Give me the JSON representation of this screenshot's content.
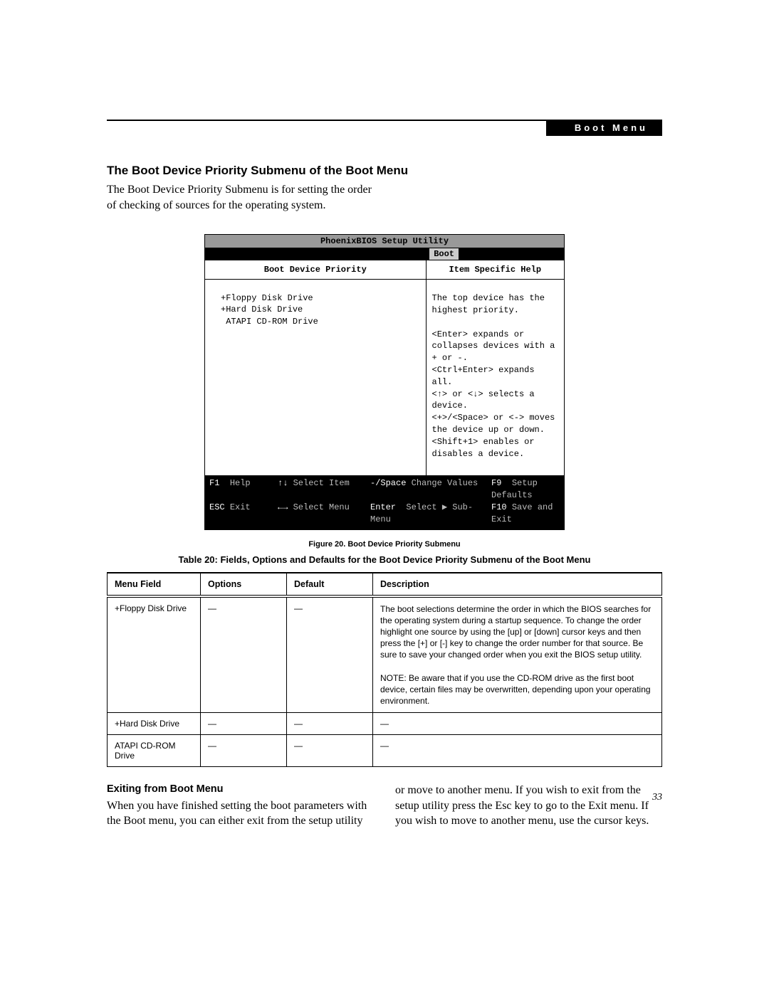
{
  "header": {
    "tab_label": "Boot Menu"
  },
  "section": {
    "heading": "The Boot Device Priority Submenu of the Boot Menu",
    "intro": "The Boot Device Priority Submenu is for setting the order of checking of sources for the operating system."
  },
  "bios": {
    "title": "PhoenixBIOS Setup Utility",
    "active_tab": "Boot",
    "left_heading": "Boot Device Priority",
    "right_heading": "Item Specific Help",
    "devices": {
      "d0": "+Floppy Disk Drive",
      "d1": "+Hard Disk Drive",
      "d2": " ATAPI CD-ROM Drive"
    },
    "help": {
      "l0": "The top device has the highest priority.",
      "l1": "<Enter> expands or collapses devices with a + or -.",
      "l2": "<Ctrl+Enter> expands all.",
      "l3": "<↑> or <↓> selects a device.",
      "l4": "<+>/<Space> or <-> moves the device up or down.",
      "l5": "<Shift+1> enables or disables a device."
    },
    "foot": {
      "r0c0k": "F1",
      "r0c0v": "Help",
      "r0c1k": "↑↓",
      "r0c1v": "Select Item",
      "r0c2k": "-/Space",
      "r0c2v": "Change Values",
      "r0c3k": "F9",
      "r0c3v": "Setup Defaults",
      "r1c0k": "ESC",
      "r1c0v": "Exit",
      "r1c1k": "←→",
      "r1c1v": "Select Menu",
      "r1c2k": "Enter",
      "r1c2v": "Select ▶ Sub-Menu",
      "r1c3k": "F10",
      "r1c3v": "Save and Exit"
    }
  },
  "figure_caption": "Figure 20.  Boot Device Priority Submenu",
  "table_caption": "Table 20: Fields, Options and Defaults for the Boot Device Priority Submenu of the Boot Menu",
  "table": {
    "headers": {
      "h0": "Menu Field",
      "h1": "Options",
      "h2": "Default",
      "h3": "Description"
    },
    "rows": {
      "r0": {
        "field": "+Floppy Disk Drive",
        "options": "—",
        "def": "—",
        "desc_a": "The boot selections determine the order in which the BIOS searches for the operating system during a startup sequence. To change the order highlight one source by using the [up] or [down] cursor keys and then press the [+] or [-] key to change the order number for that source. Be sure to save your changed order when you exit the BIOS setup utility.",
        "desc_b": "NOTE: Be aware that if you use the CD-ROM drive as the first boot device, certain files may be overwritten, depending upon your operating environment."
      },
      "r1": {
        "field": "+Hard Disk Drive",
        "options": "—",
        "def": "—",
        "desc": "—"
      },
      "r2": {
        "field": "ATAPI CD-ROM Drive",
        "options": "—",
        "def": "—",
        "desc": "—"
      }
    }
  },
  "exit": {
    "heading": "Exiting from Boot Menu",
    "body": "When you have finished setting the boot parameters with the Boot menu, you can either exit from the setup utility or move to another menu. If you wish to exit from the setup utility press the Esc key to go to the Exit menu. If you wish to move to another menu, use the cursor keys."
  },
  "page_number": "33"
}
